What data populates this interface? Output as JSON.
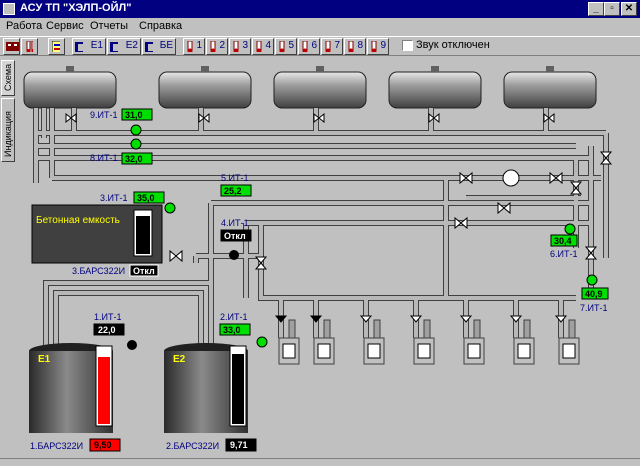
{
  "window": {
    "title": "АСУ ТП \"ХЭЛП-ОЙЛ\""
  },
  "menu": [
    "Работа",
    "Сервис",
    "Отчеты",
    "Справка"
  ],
  "toolbar": {
    "tank_buttons": [
      "E1",
      "E2",
      "БЕ"
    ],
    "pump_buttons": [
      "1",
      "2",
      "3",
      "4",
      "5",
      "6",
      "7",
      "8",
      "9"
    ],
    "sound_off_label": "Звук отключен"
  },
  "side_tabs": [
    "Схема",
    "Индикация"
  ],
  "sensors": {
    "it9": {
      "name": "9.ИТ-1",
      "value": "31,0"
    },
    "it8": {
      "name": "8.ИТ-1",
      "value": "32,0"
    },
    "it3": {
      "name": "3.ИТ-1",
      "value": "35,0"
    },
    "it5": {
      "name": "5.ИТ-1",
      "value": "25,2"
    },
    "it4": {
      "name": "4.ИТ-1",
      "value": "Откл"
    },
    "it6": {
      "name": "6.ИТ-1",
      "value": "30,4"
    },
    "it7": {
      "name": "7.ИТ-1",
      "value": "40,9"
    },
    "it1": {
      "name": "1.ИТ-1",
      "value": "22,0"
    },
    "it2": {
      "name": "2.ИТ-1",
      "value": "33,0"
    }
  },
  "concrete_tank": {
    "label": "Бетонная емкость",
    "bars_name": "3.БАРС322И",
    "bars_value": "Откл",
    "fill_level": 0.92
  },
  "tank_e1": {
    "label": "E1",
    "bars_name": "1.БАРС322И",
    "bars_value": "9,50",
    "fill_level": 0.88,
    "fill_color": "#ff0000"
  },
  "tank_e2": {
    "label": "E2",
    "bars_name": "2.БАРС322И",
    "bars_value": "9,71",
    "fill_level": 0.92,
    "fill_color": "#000000"
  },
  "colors": {
    "green": "#00e000",
    "pipe": "#a8a8a8",
    "tank_body": "#606060",
    "label_blue": "#000080"
  }
}
